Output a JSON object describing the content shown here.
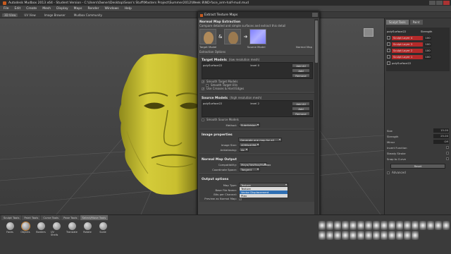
{
  "window": {
    "title": "Autodesk Mudbox 2013 x64 - Student Version - C:\\Users\\Owner\\Desktop\\Sean's Stuff\\Masters Project\\Summer2012\\Week 8\\ND-face_arm-half-mud.mud"
  },
  "menubar": [
    "File",
    "Edit",
    "Create",
    "Mesh",
    "Display",
    "Maps",
    "Render",
    "Windows",
    "Help"
  ],
  "view_tabs": [
    "3D View",
    "UV View",
    "Image Browser",
    "Mudbox Community"
  ],
  "dialog": {
    "title": "Extract Texture Maps",
    "section_title": "Normal Map Extraction",
    "description": "Compare detailed and simple surfaces and extract this detail",
    "diagram_labels": {
      "target": "Target Model",
      "source": "Source Model",
      "map": "Normal Map"
    },
    "extraction_options": "Extraction Options",
    "target_models_label": "Target Models",
    "target_models_hint": "(low resolution mesh)",
    "target_list": [
      {
        "name": "polySurface22",
        "level": "level 0"
      }
    ],
    "target_buttons": [
      "Add All",
      "Add Selected",
      "Remove"
    ],
    "checkboxes": [
      {
        "label": "Smooth Target Models",
        "checked": true
      },
      {
        "label": "Smooth Target UVs",
        "checked": false
      },
      {
        "label": "Use Creases & Hard Edges",
        "checked": true
      }
    ],
    "source_models_label": "Source Models",
    "source_models_hint": "(high resolution mesh)",
    "source_list": [
      {
        "name": "polySurface22",
        "level": "level 2"
      }
    ],
    "source_buttons": [
      "Add All",
      "Add Selected",
      "Remove"
    ],
    "smooth_source": {
      "label": "Smooth Source Models",
      "checked": false
    },
    "method": {
      "label": "Method:",
      "value": "Subdivision"
    },
    "image_properties_title": "Image properties",
    "generate_option": "Generate one map for all targets",
    "image_size": {
      "label": "Image Size:",
      "value": "4096x4096"
    },
    "antialiasing": {
      "label": "Antialiasing:",
      "value": "4x"
    },
    "normal_map_output_title": "Normal Map Output",
    "compatibility": {
      "label": "Compatibility:",
      "value": "Maya/3dsMax/Mudbox"
    },
    "coordinate_space": {
      "label": "Coordinate Space:",
      "value": "Tangent"
    },
    "output_options_title": "Output options",
    "map_type": {
      "label": "Map Type:",
      "value": "Texture"
    },
    "map_type_options": [
      "Texture",
      "Vector Displacement",
      "Ptex"
    ],
    "base_file_name": {
      "label": "Base File Name:",
      "value": "C:/..."
    },
    "bits_per_channel": {
      "label": "Bits per Channel:",
      "value": "8 bit"
    },
    "preview": {
      "label": "Preview as Normal Map:",
      "checked": true
    },
    "footer_buttons": [
      "Help",
      "Extract",
      "Close",
      "Close"
    ]
  },
  "right_panel": {
    "tabs": [
      "Sculpt Tools",
      "Paint"
    ],
    "layers": [
      {
        "name": "polySurface22",
        "value": "Strength",
        "root": true
      },
      {
        "name": "Sculpt Layer 4",
        "value": "100"
      },
      {
        "name": "Sculpt Layer 3",
        "value": "100"
      },
      {
        "name": "Sculpt Layer 2",
        "value": "100"
      },
      {
        "name": "Sculpt Layer 1",
        "value": "100"
      },
      {
        "name": "polySurface22",
        "value": ""
      }
    ],
    "properties": [
      {
        "label": "Size",
        "value": "15.00"
      },
      {
        "label": "Strength",
        "value": "25.00"
      },
      {
        "label": "Mirror",
        "value": "Off"
      },
      {
        "label": "Invert Function",
        "value": ""
      },
      {
        "label": "Steady Stroke",
        "value": ""
      },
      {
        "label": "Snap to Curve",
        "value": ""
      }
    ],
    "reset_label": "Reset",
    "advanced_label": "Advanced"
  },
  "bottom_shelf": {
    "tabs": [
      "Sculpt Tools",
      "Paint Tools",
      "Curve Tools",
      "Pose Tools",
      "Select/Move Tools"
    ],
    "active_tab": "Select/Move Tools",
    "tools": [
      "Faces",
      "Objects",
      "Borders",
      "UV Shells",
      "Translate",
      "Rotate",
      "Scale"
    ],
    "selected_tool": "Objects"
  }
}
